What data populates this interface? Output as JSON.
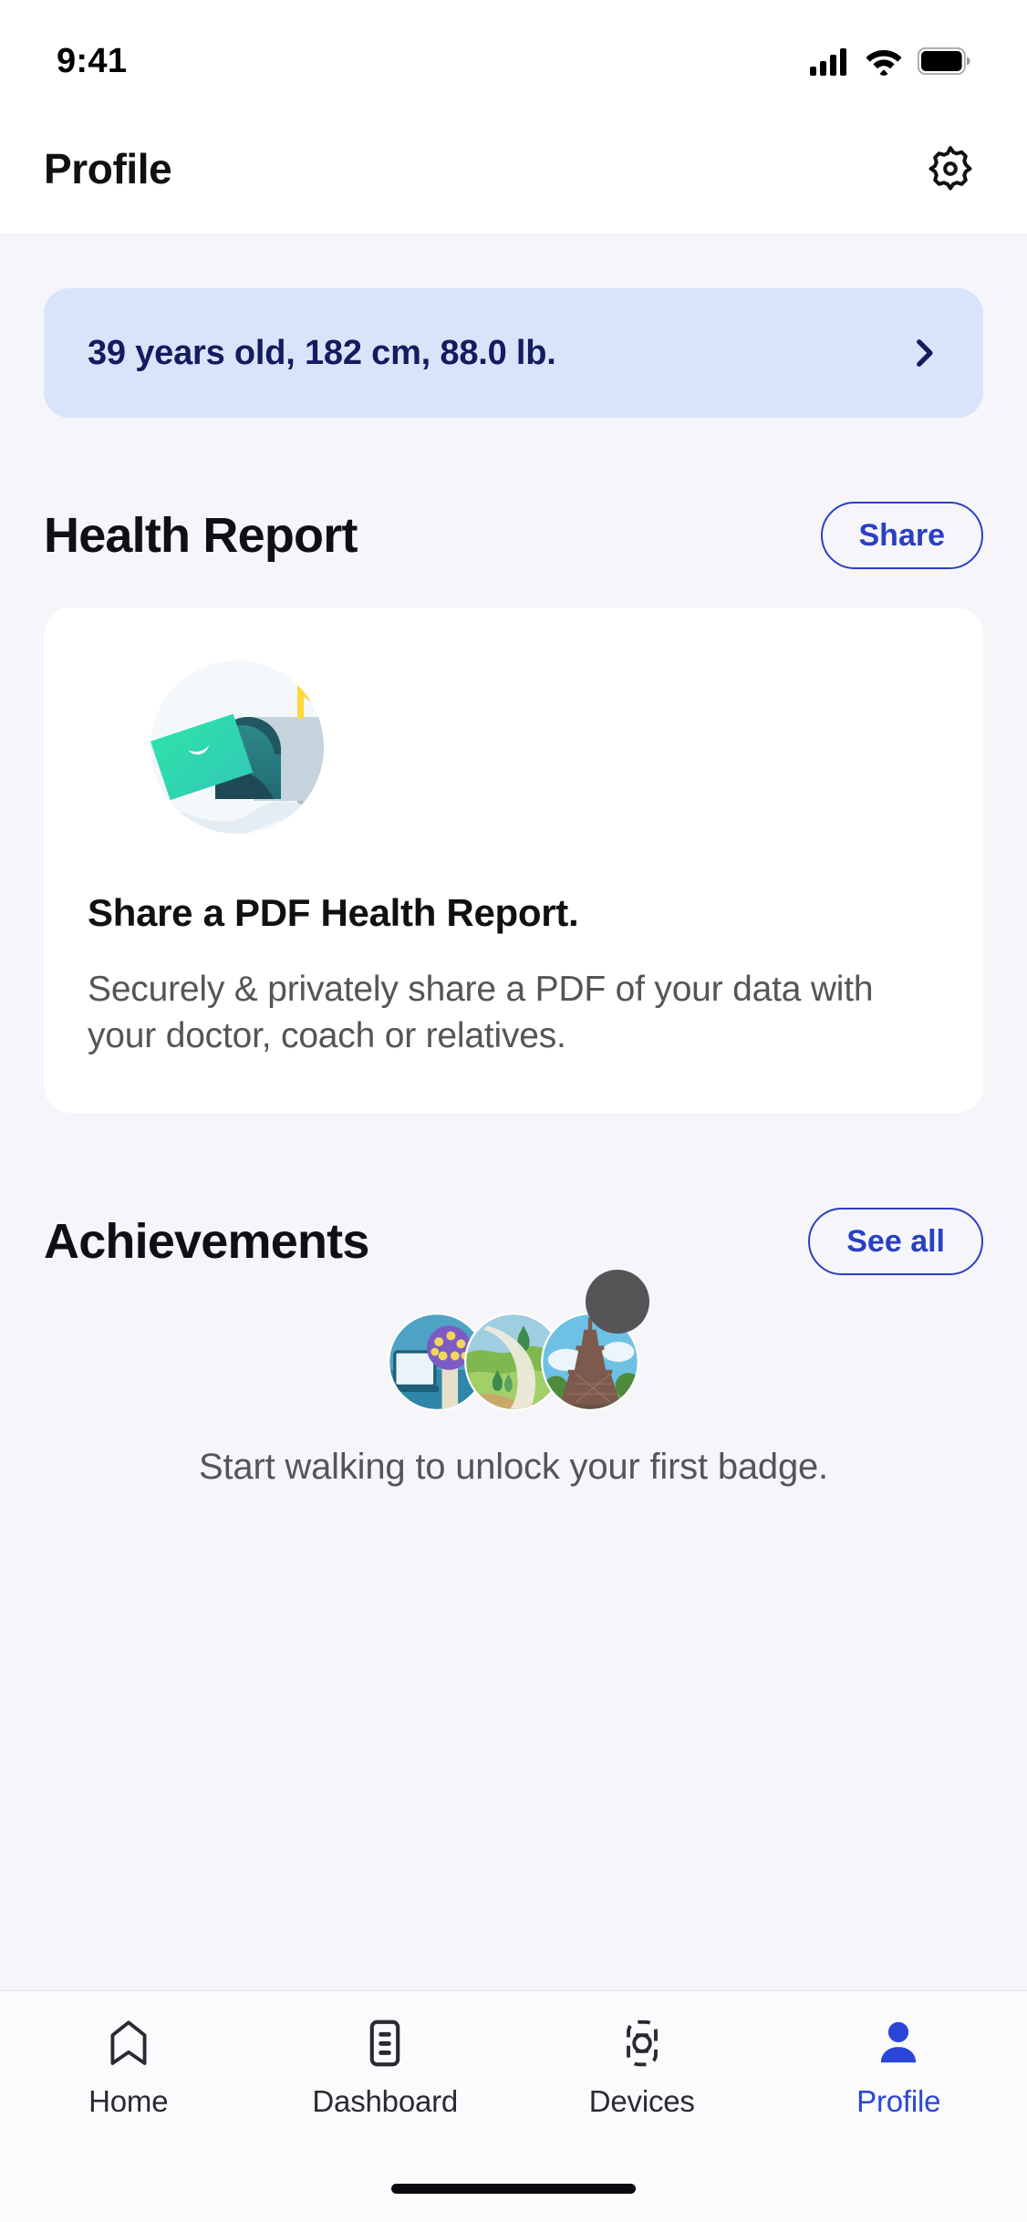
{
  "status_bar": {
    "time": "9:41",
    "icons": [
      "cellular-signal-icon",
      "wifi-icon",
      "battery-icon"
    ]
  },
  "header": {
    "title": "Profile",
    "settings_icon": "gear-icon"
  },
  "info_banner": {
    "text": "39 years old, 182 cm, 88.0 lb.",
    "chevron_icon": "chevron-right-icon",
    "bg_color": "#D9E4FB",
    "text_color": "#131C5E"
  },
  "health_report": {
    "section_title": "Health Report",
    "share_button": "Share",
    "card": {
      "illustration": "mailbox-envelope-illustration",
      "title": "Share a PDF Health Report.",
      "body": "Securely & privately share a PDF of your data with your doctor, coach or relatives."
    }
  },
  "achievements": {
    "section_title": "Achievements",
    "see_all_button": "See all",
    "badges": [
      "badge-purple-tree",
      "badge-green-hills",
      "badge-eiffel-tower"
    ],
    "caption": "Start walking to unlock your first badge."
  },
  "tab_bar": {
    "tabs": [
      {
        "label": "Home",
        "icon": "home-icon",
        "active": false
      },
      {
        "label": "Dashboard",
        "icon": "dashboard-icon",
        "active": false
      },
      {
        "label": "Devices",
        "icon": "watch-icon",
        "active": false
      },
      {
        "label": "Profile",
        "icon": "person-icon",
        "active": true
      }
    ],
    "active_color": "#2A46D8",
    "inactive_color": "#2A2A30"
  },
  "cursor": {
    "shape": "circle",
    "color": "#555558"
  },
  "colors": {
    "page_bg": "#F6F6FA",
    "card_bg": "#FFFFFF",
    "accent_blue": "#2B3FC4",
    "text_primary": "#111114",
    "text_secondary": "#555558"
  }
}
